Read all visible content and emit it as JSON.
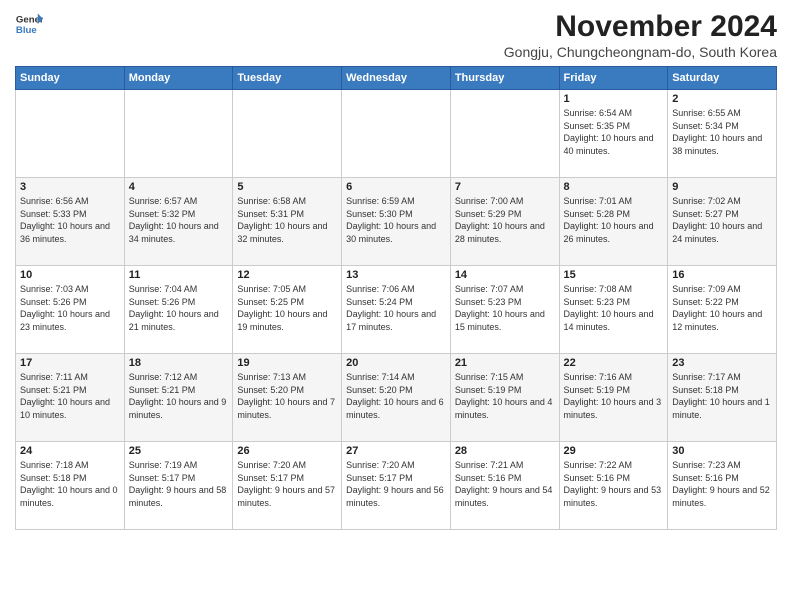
{
  "logo": {
    "line1": "General",
    "line2": "Blue"
  },
  "title": "November 2024",
  "location": "Gongju, Chungcheongnam-do, South Korea",
  "weekdays": [
    "Sunday",
    "Monday",
    "Tuesday",
    "Wednesday",
    "Thursday",
    "Friday",
    "Saturday"
  ],
  "weeks": [
    [
      {
        "day": "",
        "info": ""
      },
      {
        "day": "",
        "info": ""
      },
      {
        "day": "",
        "info": ""
      },
      {
        "day": "",
        "info": ""
      },
      {
        "day": "",
        "info": ""
      },
      {
        "day": "1",
        "info": "Sunrise: 6:54 AM\nSunset: 5:35 PM\nDaylight: 10 hours and 40 minutes."
      },
      {
        "day": "2",
        "info": "Sunrise: 6:55 AM\nSunset: 5:34 PM\nDaylight: 10 hours and 38 minutes."
      }
    ],
    [
      {
        "day": "3",
        "info": "Sunrise: 6:56 AM\nSunset: 5:33 PM\nDaylight: 10 hours and 36 minutes."
      },
      {
        "day": "4",
        "info": "Sunrise: 6:57 AM\nSunset: 5:32 PM\nDaylight: 10 hours and 34 minutes."
      },
      {
        "day": "5",
        "info": "Sunrise: 6:58 AM\nSunset: 5:31 PM\nDaylight: 10 hours and 32 minutes."
      },
      {
        "day": "6",
        "info": "Sunrise: 6:59 AM\nSunset: 5:30 PM\nDaylight: 10 hours and 30 minutes."
      },
      {
        "day": "7",
        "info": "Sunrise: 7:00 AM\nSunset: 5:29 PM\nDaylight: 10 hours and 28 minutes."
      },
      {
        "day": "8",
        "info": "Sunrise: 7:01 AM\nSunset: 5:28 PM\nDaylight: 10 hours and 26 minutes."
      },
      {
        "day": "9",
        "info": "Sunrise: 7:02 AM\nSunset: 5:27 PM\nDaylight: 10 hours and 24 minutes."
      }
    ],
    [
      {
        "day": "10",
        "info": "Sunrise: 7:03 AM\nSunset: 5:26 PM\nDaylight: 10 hours and 23 minutes."
      },
      {
        "day": "11",
        "info": "Sunrise: 7:04 AM\nSunset: 5:26 PM\nDaylight: 10 hours and 21 minutes."
      },
      {
        "day": "12",
        "info": "Sunrise: 7:05 AM\nSunset: 5:25 PM\nDaylight: 10 hours and 19 minutes."
      },
      {
        "day": "13",
        "info": "Sunrise: 7:06 AM\nSunset: 5:24 PM\nDaylight: 10 hours and 17 minutes."
      },
      {
        "day": "14",
        "info": "Sunrise: 7:07 AM\nSunset: 5:23 PM\nDaylight: 10 hours and 15 minutes."
      },
      {
        "day": "15",
        "info": "Sunrise: 7:08 AM\nSunset: 5:23 PM\nDaylight: 10 hours and 14 minutes."
      },
      {
        "day": "16",
        "info": "Sunrise: 7:09 AM\nSunset: 5:22 PM\nDaylight: 10 hours and 12 minutes."
      }
    ],
    [
      {
        "day": "17",
        "info": "Sunrise: 7:11 AM\nSunset: 5:21 PM\nDaylight: 10 hours and 10 minutes."
      },
      {
        "day": "18",
        "info": "Sunrise: 7:12 AM\nSunset: 5:21 PM\nDaylight: 10 hours and 9 minutes."
      },
      {
        "day": "19",
        "info": "Sunrise: 7:13 AM\nSunset: 5:20 PM\nDaylight: 10 hours and 7 minutes."
      },
      {
        "day": "20",
        "info": "Sunrise: 7:14 AM\nSunset: 5:20 PM\nDaylight: 10 hours and 6 minutes."
      },
      {
        "day": "21",
        "info": "Sunrise: 7:15 AM\nSunset: 5:19 PM\nDaylight: 10 hours and 4 minutes."
      },
      {
        "day": "22",
        "info": "Sunrise: 7:16 AM\nSunset: 5:19 PM\nDaylight: 10 hours and 3 minutes."
      },
      {
        "day": "23",
        "info": "Sunrise: 7:17 AM\nSunset: 5:18 PM\nDaylight: 10 hours and 1 minute."
      }
    ],
    [
      {
        "day": "24",
        "info": "Sunrise: 7:18 AM\nSunset: 5:18 PM\nDaylight: 10 hours and 0 minutes."
      },
      {
        "day": "25",
        "info": "Sunrise: 7:19 AM\nSunset: 5:17 PM\nDaylight: 9 hours and 58 minutes."
      },
      {
        "day": "26",
        "info": "Sunrise: 7:20 AM\nSunset: 5:17 PM\nDaylight: 9 hours and 57 minutes."
      },
      {
        "day": "27",
        "info": "Sunrise: 7:20 AM\nSunset: 5:17 PM\nDaylight: 9 hours and 56 minutes."
      },
      {
        "day": "28",
        "info": "Sunrise: 7:21 AM\nSunset: 5:16 PM\nDaylight: 9 hours and 54 minutes."
      },
      {
        "day": "29",
        "info": "Sunrise: 7:22 AM\nSunset: 5:16 PM\nDaylight: 9 hours and 53 minutes."
      },
      {
        "day": "30",
        "info": "Sunrise: 7:23 AM\nSunset: 5:16 PM\nDaylight: 9 hours and 52 minutes."
      }
    ]
  ]
}
